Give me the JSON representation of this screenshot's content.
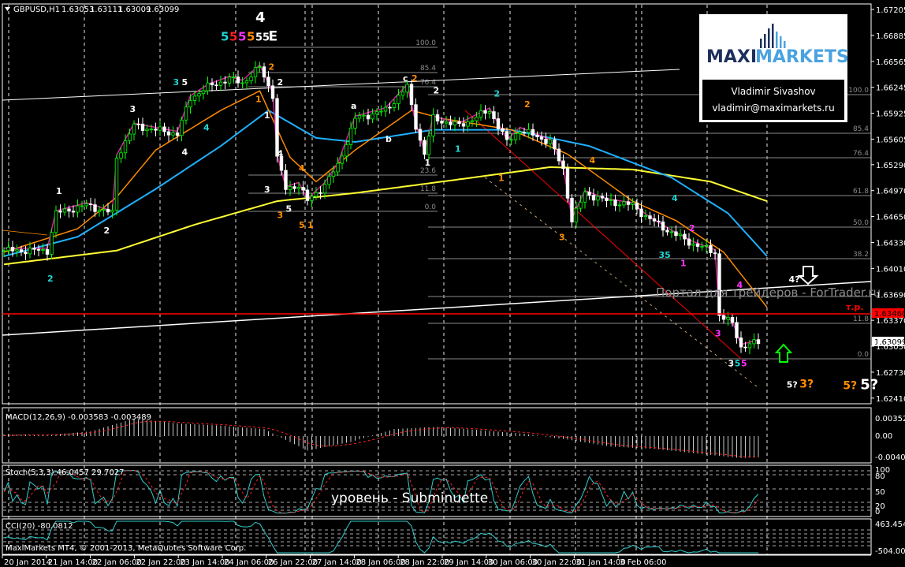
{
  "header": {
    "symbol": "GBPUSD,H1",
    "open": "1.63053",
    "high": "1.63111",
    "low": "1.63009",
    "close": "1.63099"
  },
  "price_axis": [
    "1.67205",
    "1.66885",
    "1.66565",
    "1.66245",
    "1.65925",
    "1.65605",
    "1.65290",
    "1.64970",
    "1.64650",
    "1.64330",
    "1.64010",
    "1.63690",
    "1.63370",
    "1.63050",
    "1.62730",
    "1.62410"
  ],
  "time_axis": [
    "20 Jan 2014",
    "21 Jan 14:00",
    "22 Jan 06:00",
    "22 Jan 22:00",
    "23 Jan 14:00",
    "24 Jan 06:00",
    "26 Jan 22:00",
    "27 Jan 14:00",
    "28 Jan 06:00",
    "28 Jan 22:00",
    "29 Jan 14:00",
    "30 Jan 06:00",
    "30 Jan 22:00",
    "31 Jan 14:00",
    "3 Feb 06:00"
  ],
  "current_price_label": "1.63099",
  "target_line": {
    "price": 1.6346,
    "label": "1.63460",
    "text": "т.р.",
    "color": "#ff0000"
  },
  "logo": {
    "brand_a": "MAXI",
    "brand_b": "MARKETS",
    "author": "Vladimir Sivashov",
    "email": "vladimir@maximarkets.ru"
  },
  "watermark": "Портал для трейдеров - ForTrader.ru",
  "level_text": "уровень - Subminuette",
  "copyright": "MaxiMarkets MT4, © 2001-2013, MetaQuotes Software Corp.",
  "fib_right": [
    "100.0",
    "85.4",
    "76.4",
    "61.8",
    "50.0",
    "38.2",
    "11.8",
    "0.0"
  ],
  "fib_left": [
    "100.0",
    "85.4",
    "76.4",
    "23.6",
    "11.8",
    "0.0"
  ],
  "macd": {
    "label": "MACD(12,26,9) -0.003583 -0.003489",
    "axis": [
      "0.003526",
      "0.00",
      "-0.00407"
    ]
  },
  "stoch": {
    "label": "Stoch(5,3,3) 46.0457 29.7027",
    "axis": [
      "100",
      "80",
      "50",
      "20",
      "0"
    ]
  },
  "cci": {
    "label": "CCI(20) -80.0812",
    "axis": [
      "463.4546",
      "-504.0085"
    ]
  },
  "colors": {
    "bull": "#00ff00",
    "bear": "#ffffff",
    "ma_fast": "#ff8c00",
    "ma_mid": "#1fb0ff",
    "ma_slow": "#ffff33",
    "ma_wave": "#d0209a",
    "grid": "#ffffff"
  },
  "chart_data": {
    "type": "candlestick",
    "close_keypoints": [
      [
        0,
        1.6423
      ],
      [
        10,
        1.6423
      ],
      [
        12,
        1.6469
      ],
      [
        19,
        1.6479
      ],
      [
        25,
        1.6469
      ],
      [
        26,
        1.6538
      ],
      [
        30,
        1.6577
      ],
      [
        35,
        1.6572
      ],
      [
        40,
        1.6567
      ],
      [
        43,
        1.6611
      ],
      [
        47,
        1.6625
      ],
      [
        52,
        1.6635
      ],
      [
        55,
        1.663
      ],
      [
        59,
        1.6649
      ],
      [
        62,
        1.6615
      ],
      [
        63,
        1.6538
      ],
      [
        65,
        1.6499
      ],
      [
        68,
        1.6504
      ],
      [
        70,
        1.6484
      ],
      [
        74,
        1.6504
      ],
      [
        77,
        1.6528
      ],
      [
        81,
        1.6586
      ],
      [
        88,
        1.6596
      ],
      [
        93,
        1.6625
      ],
      [
        95,
        1.6577
      ],
      [
        97,
        1.6542
      ],
      [
        99,
        1.6586
      ],
      [
        105,
        1.6577
      ],
      [
        112,
        1.6596
      ],
      [
        116,
        1.6557
      ],
      [
        119,
        1.6572
      ],
      [
        126,
        1.6557
      ],
      [
        129,
        1.6523
      ],
      [
        131,
        1.646
      ],
      [
        134,
        1.6494
      ],
      [
        139,
        1.6484
      ],
      [
        145,
        1.6479
      ],
      [
        148,
        1.6465
      ],
      [
        154,
        1.6445
      ],
      [
        159,
        1.6431
      ],
      [
        164,
        1.6421
      ],
      [
        165,
        1.6343
      ],
      [
        168,
        1.6333
      ],
      [
        170,
        1.6304
      ],
      [
        174,
        1.631
      ]
    ],
    "ma_slow": [
      [
        0,
        1.6406
      ],
      [
        26,
        1.6423
      ],
      [
        44,
        1.6455
      ],
      [
        63,
        1.6484
      ],
      [
        81,
        1.6494
      ],
      [
        108,
        1.6513
      ],
      [
        126,
        1.6526
      ],
      [
        145,
        1.6523
      ],
      [
        163,
        1.6508
      ],
      [
        176,
        1.6484
      ]
    ],
    "ma_mid": [
      [
        0,
        1.6416
      ],
      [
        17,
        1.644
      ],
      [
        35,
        1.6499
      ],
      [
        50,
        1.6552
      ],
      [
        61,
        1.6596
      ],
      [
        72,
        1.6562
      ],
      [
        81,
        1.6557
      ],
      [
        99,
        1.6572
      ],
      [
        117,
        1.6572
      ],
      [
        135,
        1.6552
      ],
      [
        154,
        1.6513
      ],
      [
        167,
        1.6469
      ],
      [
        176,
        1.6416
      ]
    ],
    "ma_fast": [
      [
        0,
        1.6421
      ],
      [
        17,
        1.645
      ],
      [
        26,
        1.6489
      ],
      [
        35,
        1.6547
      ],
      [
        50,
        1.6596
      ],
      [
        59,
        1.662
      ],
      [
        66,
        1.6538
      ],
      [
        72,
        1.6508
      ],
      [
        81,
        1.6547
      ],
      [
        94,
        1.6596
      ],
      [
        101,
        1.6586
      ],
      [
        117,
        1.6572
      ],
      [
        130,
        1.6542
      ],
      [
        145,
        1.6484
      ],
      [
        155,
        1.646
      ],
      [
        166,
        1.6421
      ],
      [
        176,
        1.6353
      ]
    ],
    "macd_keypoints": [
      [
        0,
        0.0003
      ],
      [
        10,
        0.0002
      ],
      [
        20,
        0.0008
      ],
      [
        30,
        0.003
      ],
      [
        40,
        0.0022
      ],
      [
        50,
        0.0018
      ],
      [
        60,
        0.0012
      ],
      [
        70,
        -0.0025
      ],
      [
        80,
        -0.001
      ],
      [
        90,
        0.0012
      ],
      [
        100,
        0.0016
      ],
      [
        110,
        0.001
      ],
      [
        120,
        0.0004
      ],
      [
        130,
        -0.0006
      ],
      [
        140,
        -0.0018
      ],
      [
        150,
        -0.0022
      ],
      [
        160,
        -0.003
      ],
      [
        170,
        -0.0038
      ],
      [
        175,
        -0.0036
      ]
    ],
    "annotations": [
      {
        "t": "4",
        "c": "#ffffff",
        "bar": 58,
        "p": 1.6705,
        "s": 18
      },
      {
        "t": "5",
        "c": "#22d3d3",
        "bar": 50,
        "p": 1.6682,
        "s": 15
      },
      {
        "t": "5",
        "c": "#ff2020",
        "bar": 52,
        "p": 1.6682,
        "s": 15
      },
      {
        "t": "5",
        "c": "#ff33ff",
        "bar": 54,
        "p": 1.6682,
        "s": 15
      },
      {
        "t": "5",
        "c": "#ff8c00",
        "bar": 56,
        "p": 1.6682,
        "s": 15
      },
      {
        "t": "55",
        "c": "#ffffff",
        "bar": 58,
        "p": 1.6682,
        "s": 13
      },
      {
        "t": "E",
        "c": "#ffffff",
        "bar": 61,
        "p": 1.6682,
        "s": 17
      },
      {
        "t": "2",
        "c": "#22d3d3",
        "bar": 10,
        "p": 1.6385,
        "s": 11
      },
      {
        "t": "1",
        "c": "#ffffff",
        "bar": 12,
        "p": 1.6493,
        "s": 11
      },
      {
        "t": "2",
        "c": "#ffffff",
        "bar": 23,
        "p": 1.6444,
        "s": 11
      },
      {
        "t": "3",
        "c": "#ffffff",
        "bar": 29,
        "p": 1.6594,
        "s": 11
      },
      {
        "t": "3",
        "c": "#22d3d3",
        "bar": 39,
        "p": 1.6627,
        "s": 11
      },
      {
        "t": "5",
        "c": "#ffffff",
        "bar": 41,
        "p": 1.6627,
        "s": 11
      },
      {
        "t": "4",
        "c": "#ffffff",
        "bar": 41,
        "p": 1.6541,
        "s": 11
      },
      {
        "t": "4",
        "c": "#22d3d3",
        "bar": 46,
        "p": 1.6571,
        "s": 11
      },
      {
        "t": "2",
        "c": "#ff8c00",
        "bar": 61,
        "p": 1.6646,
        "s": 11
      },
      {
        "t": "2",
        "c": "#ffffff",
        "bar": 63,
        "p": 1.6627,
        "s": 11
      },
      {
        "t": "1",
        "c": "#ff8c00",
        "bar": 58,
        "p": 1.6606,
        "s": 11
      },
      {
        "t": "1",
        "c": "#ffffff",
        "bar": 60,
        "p": 1.6586,
        "s": 11
      },
      {
        "t": "4",
        "c": "#ffffff",
        "bar": 63,
        "p": 1.6539,
        "s": 11
      },
      {
        "t": "4",
        "c": "#ff8c00",
        "bar": 68,
        "p": 1.6521,
        "s": 11
      },
      {
        "t": "3",
        "c": "#ffffff",
        "bar": 60,
        "p": 1.6495,
        "s": 11
      },
      {
        "t": "5",
        "c": "#ffffff",
        "bar": 65,
        "p": 1.6471,
        "s": 11
      },
      {
        "t": "3",
        "c": "#ff8c00",
        "bar": 63,
        "p": 1.6463,
        "s": 11
      },
      {
        "t": "5",
        "c": "#ff8c00",
        "bar": 68,
        "p": 1.6451,
        "s": 11
      },
      {
        "t": "1",
        "c": "#ff8c00",
        "bar": 70,
        "p": 1.6451,
        "s": 11
      },
      {
        "t": "a",
        "c": "#ffffff",
        "bar": 80,
        "p": 1.6598,
        "s": 11
      },
      {
        "t": "b",
        "c": "#ffffff",
        "bar": 88,
        "p": 1.6557,
        "s": 11
      },
      {
        "t": "c",
        "c": "#ffffff",
        "bar": 92,
        "p": 1.6632,
        "s": 11
      },
      {
        "t": "2",
        "c": "#ff8c00",
        "bar": 94,
        "p": 1.6632,
        "s": 11
      },
      {
        "t": "2",
        "c": "#ffffff",
        "bar": 99,
        "p": 1.6617,
        "s": 11
      },
      {
        "t": "1",
        "c": "#ffffff",
        "bar": 97,
        "p": 1.6528,
        "s": 11
      },
      {
        "t": "1",
        "c": "#22d3d3",
        "bar": 104,
        "p": 1.6545,
        "s": 11
      },
      {
        "t": "1",
        "c": "#ff8c00",
        "bar": 114,
        "p": 1.6509,
        "s": 11
      },
      {
        "t": "2",
        "c": "#22d3d3",
        "bar": 113,
        "p": 1.6613,
        "s": 11
      },
      {
        "t": "2",
        "c": "#ff8c00",
        "bar": 120,
        "p": 1.66,
        "s": 11
      },
      {
        "t": "3",
        "c": "#ff8c00",
        "bar": 128,
        "p": 1.6436,
        "s": 11
      },
      {
        "t": "4",
        "c": "#ff8c00",
        "bar": 135,
        "p": 1.6531,
        "s": 11
      },
      {
        "t": "4",
        "c": "#22d3d3",
        "bar": 154,
        "p": 1.6484,
        "s": 11
      },
      {
        "t": "2",
        "c": "#ff33ff",
        "bar": 158,
        "p": 1.6447,
        "s": 11
      },
      {
        "t": "35",
        "c": "#22d3d3",
        "bar": 151,
        "p": 1.6414,
        "s": 11
      },
      {
        "t": "1",
        "c": "#ff33ff",
        "bar": 156,
        "p": 1.6404,
        "s": 11
      },
      {
        "t": "4",
        "c": "#ff33ff",
        "bar": 169,
        "p": 1.6377,
        "s": 11
      },
      {
        "t": "3",
        "c": "#ff33ff",
        "bar": 164,
        "p": 1.6317,
        "s": 11
      },
      {
        "t": "3",
        "c": "#ffffff",
        "bar": 167,
        "p": 1.628,
        "s": 11
      },
      {
        "t": "5",
        "c": "#22d3d3",
        "bar": 168.5,
        "p": 1.628,
        "s": 11
      },
      {
        "t": "5",
        "c": "#ff33ff",
        "bar": 170,
        "p": 1.628,
        "s": 11
      },
      {
        "t": "4?",
        "c": "#ffffff",
        "bar": 181,
        "p": 1.6384,
        "s": 11
      },
      {
        "t": "5?",
        "c": "#ffffff",
        "bar": 180.5,
        "p": 1.6254,
        "s": 11
      },
      {
        "t": "3?",
        "c": "#ff8c00",
        "bar": 183.5,
        "p": 1.6254,
        "s": 14
      },
      {
        "t": "5?",
        "c": "#ff8c00",
        "bar": 193.5,
        "p": 1.6252,
        "s": 14
      },
      {
        "t": "5?",
        "c": "#ffffff",
        "bar": 197.5,
        "p": 1.6252,
        "s": 18
      }
    ]
  }
}
